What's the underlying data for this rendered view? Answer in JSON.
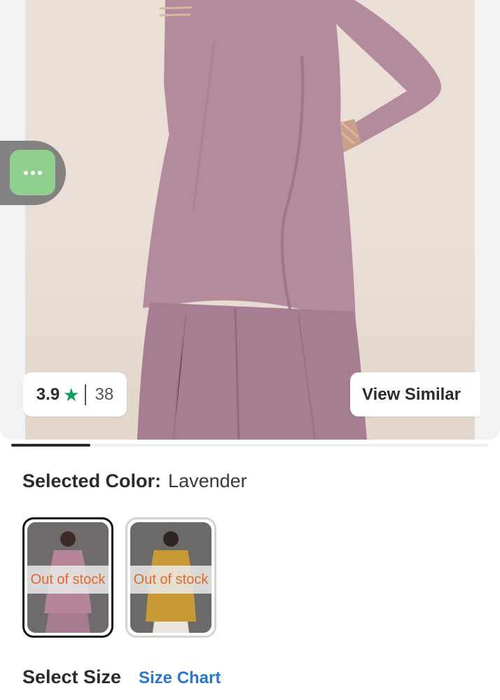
{
  "product": {
    "rating": "3.9",
    "rating_count": "38",
    "view_similar_label": "View Similar"
  },
  "color": {
    "heading_label": "Selected Color:",
    "selected_value": "Lavender",
    "swatches": [
      {
        "status": "Out of stock",
        "tint": "#b6859a"
      },
      {
        "status": "Out of stock",
        "tint": "#c89a36"
      }
    ]
  },
  "size": {
    "heading": "Select Size",
    "chart_link": "Size Chart"
  },
  "icons": {
    "more": "more-dots-icon",
    "star": "star-icon"
  },
  "colors": {
    "accent_link": "#2a78c8",
    "star": "#0f9d58",
    "out_of_stock": "#e0682c",
    "garment": "#b48a9d"
  }
}
